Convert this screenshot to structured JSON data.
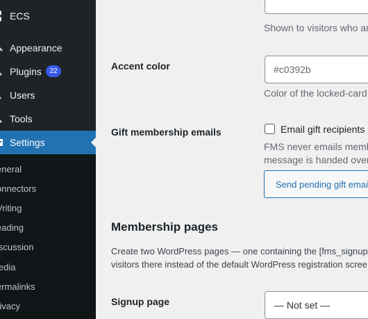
{
  "sidebar": {
    "header": {
      "label": "ECS",
      "icon": "logo-icon"
    },
    "items": [
      {
        "label": "Appearance",
        "icon": "brush-icon"
      },
      {
        "label": "Plugins",
        "icon": "plug-icon",
        "badge": "22"
      },
      {
        "label": "Users",
        "icon": "user-icon"
      },
      {
        "label": "Tools",
        "icon": "wrench-icon"
      },
      {
        "label": "Settings",
        "icon": "settings-icon",
        "active": true
      }
    ],
    "submenu": [
      "eneral",
      "onnectors",
      "Vriting",
      "eading",
      "iscussion",
      "ledia",
      "ermalinks",
      "rivacy"
    ]
  },
  "main": {
    "top_description": "Shown to visitors who ar",
    "accent": {
      "label": "Accent color",
      "placeholder": "#c0392b",
      "description": "Color of the locked-card"
    },
    "gift": {
      "label": "Gift membership emails",
      "checkbox_label": "Email gift recipients",
      "desc_line1": "FMS never emails memb",
      "desc_line2": "message is handed over",
      "button_label": "Send pending gift emai"
    },
    "membership": {
      "heading": "Membership pages",
      "para_line1": "Create two WordPress pages — one containing the [fms_signup]",
      "para_line2": "visitors there instead of the default WordPress registration scree"
    },
    "signup": {
      "label": "Signup page",
      "selected": "— Not set —"
    }
  },
  "colors": {
    "sidebar_bg": "#1d2327",
    "submenu_bg": "#101517",
    "active_bg": "#2271b1",
    "badge_bg": "#3858e9",
    "page_bg": "#f0f0f1"
  }
}
